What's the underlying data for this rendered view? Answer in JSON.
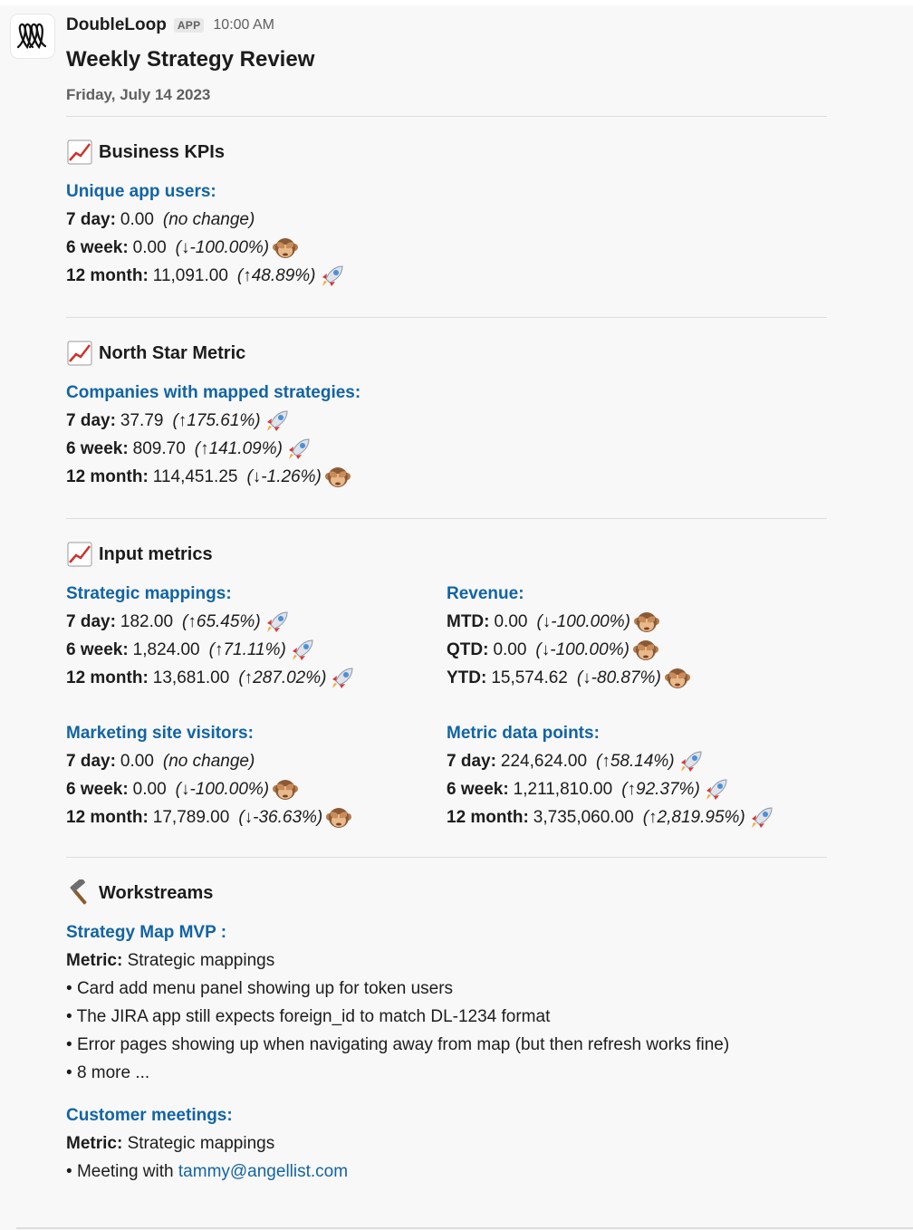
{
  "message": {
    "sender": "DoubleLoop",
    "badge": "APP",
    "time": "10:00 AM",
    "title": "Weekly Strategy Review",
    "date": "Friday, July 14 2023"
  },
  "sections": {
    "business": {
      "title": "Business KPIs",
      "group": {
        "label": "Unique app users:",
        "rows": [
          {
            "period": "7 day:",
            "value": "0.00",
            "change": "(no change)",
            "icon": ""
          },
          {
            "period": "6 week:",
            "value": "0.00",
            "change": "(↓-100.00%)",
            "icon": "see-no-evil-monkey-icon"
          },
          {
            "period": "12 month:",
            "value": "11,091.00",
            "change": "(↑48.89%)",
            "icon": "rocket-icon"
          }
        ]
      }
    },
    "northstar": {
      "title": "North Star Metric",
      "group": {
        "label": "Companies with mapped strategies:",
        "rows": [
          {
            "period": "7 day:",
            "value": "37.79",
            "change": "(↑175.61%)",
            "icon": "rocket-icon"
          },
          {
            "period": "6 week:",
            "value": "809.70",
            "change": "(↑141.09%)",
            "icon": "rocket-icon"
          },
          {
            "period": "12 month:",
            "value": "114,451.25",
            "change": "(↓-1.26%)",
            "icon": "see-no-evil-monkey-icon"
          }
        ]
      }
    },
    "input": {
      "title": "Input metrics",
      "left": [
        {
          "label": "Strategic mappings:",
          "rows": [
            {
              "period": "7 day:",
              "value": "182.00",
              "change": "(↑65.45%)",
              "icon": "rocket-icon"
            },
            {
              "period": "6 week:",
              "value": "1,824.00",
              "change": "(↑71.11%)",
              "icon": "rocket-icon"
            },
            {
              "period": "12 month:",
              "value": "13,681.00",
              "change": "(↑287.02%)",
              "icon": "rocket-icon"
            }
          ]
        },
        {
          "label": "Marketing site visitors:",
          "rows": [
            {
              "period": "7 day:",
              "value": "0.00",
              "change": "(no change)",
              "icon": ""
            },
            {
              "period": "6 week:",
              "value": "0.00",
              "change": "(↓-100.00%)",
              "icon": "see-no-evil-monkey-icon"
            },
            {
              "period": "12 month:",
              "value": "17,789.00",
              "change": "(↓-36.63%)",
              "icon": "see-no-evil-monkey-icon"
            }
          ]
        }
      ],
      "right": [
        {
          "label": "Revenue:",
          "rows": [
            {
              "period": "MTD:",
              "value": "0.00",
              "change": "(↓-100.00%)",
              "icon": "see-no-evil-monkey-icon"
            },
            {
              "period": "QTD:",
              "value": "0.00",
              "change": "(↓-100.00%)",
              "icon": "see-no-evil-monkey-icon"
            },
            {
              "period": "YTD:",
              "value": "15,574.62",
              "change": "(↓-80.87%)",
              "icon": "see-no-evil-monkey-icon"
            }
          ]
        },
        {
          "label": "Metric data points:",
          "rows": [
            {
              "period": "7 day:",
              "value": "224,624.00",
              "change": "(↑58.14%)",
              "icon": "rocket-icon"
            },
            {
              "period": "6 week:",
              "value": "1,211,810.00",
              "change": "(↑92.37%)",
              "icon": "rocket-icon"
            },
            {
              "period": "12 month:",
              "value": "3,735,060.00",
              "change": "(↑2,819.95%)",
              "icon": "rocket-icon"
            }
          ]
        }
      ]
    },
    "workstreams": {
      "title": "Workstreams",
      "items": [
        {
          "name": "Strategy Map MVP :",
          "metric_label": "Metric:",
          "metric": "Strategic mappings",
          "bullets": [
            "Card add menu panel showing up for token users",
            "The JIRA app still expects foreign_id to match DL-1234 format",
            "Error pages showing up when navigating away from map (but then refresh works fine)",
            "8 more ..."
          ]
        },
        {
          "name": "Customer meetings:",
          "metric_label": "Metric:",
          "metric": "Strategic mappings",
          "bullet_prefix": "Meeting with",
          "bullet_link": "tammy@angellist.com"
        }
      ]
    }
  },
  "icons": {
    "section_kpi": "chart-increasing-icon",
    "section_workstreams": "hammer-icon"
  },
  "colors": {
    "link": "#1264a3",
    "background": "#f8f8f8",
    "muted": "#616061"
  }
}
